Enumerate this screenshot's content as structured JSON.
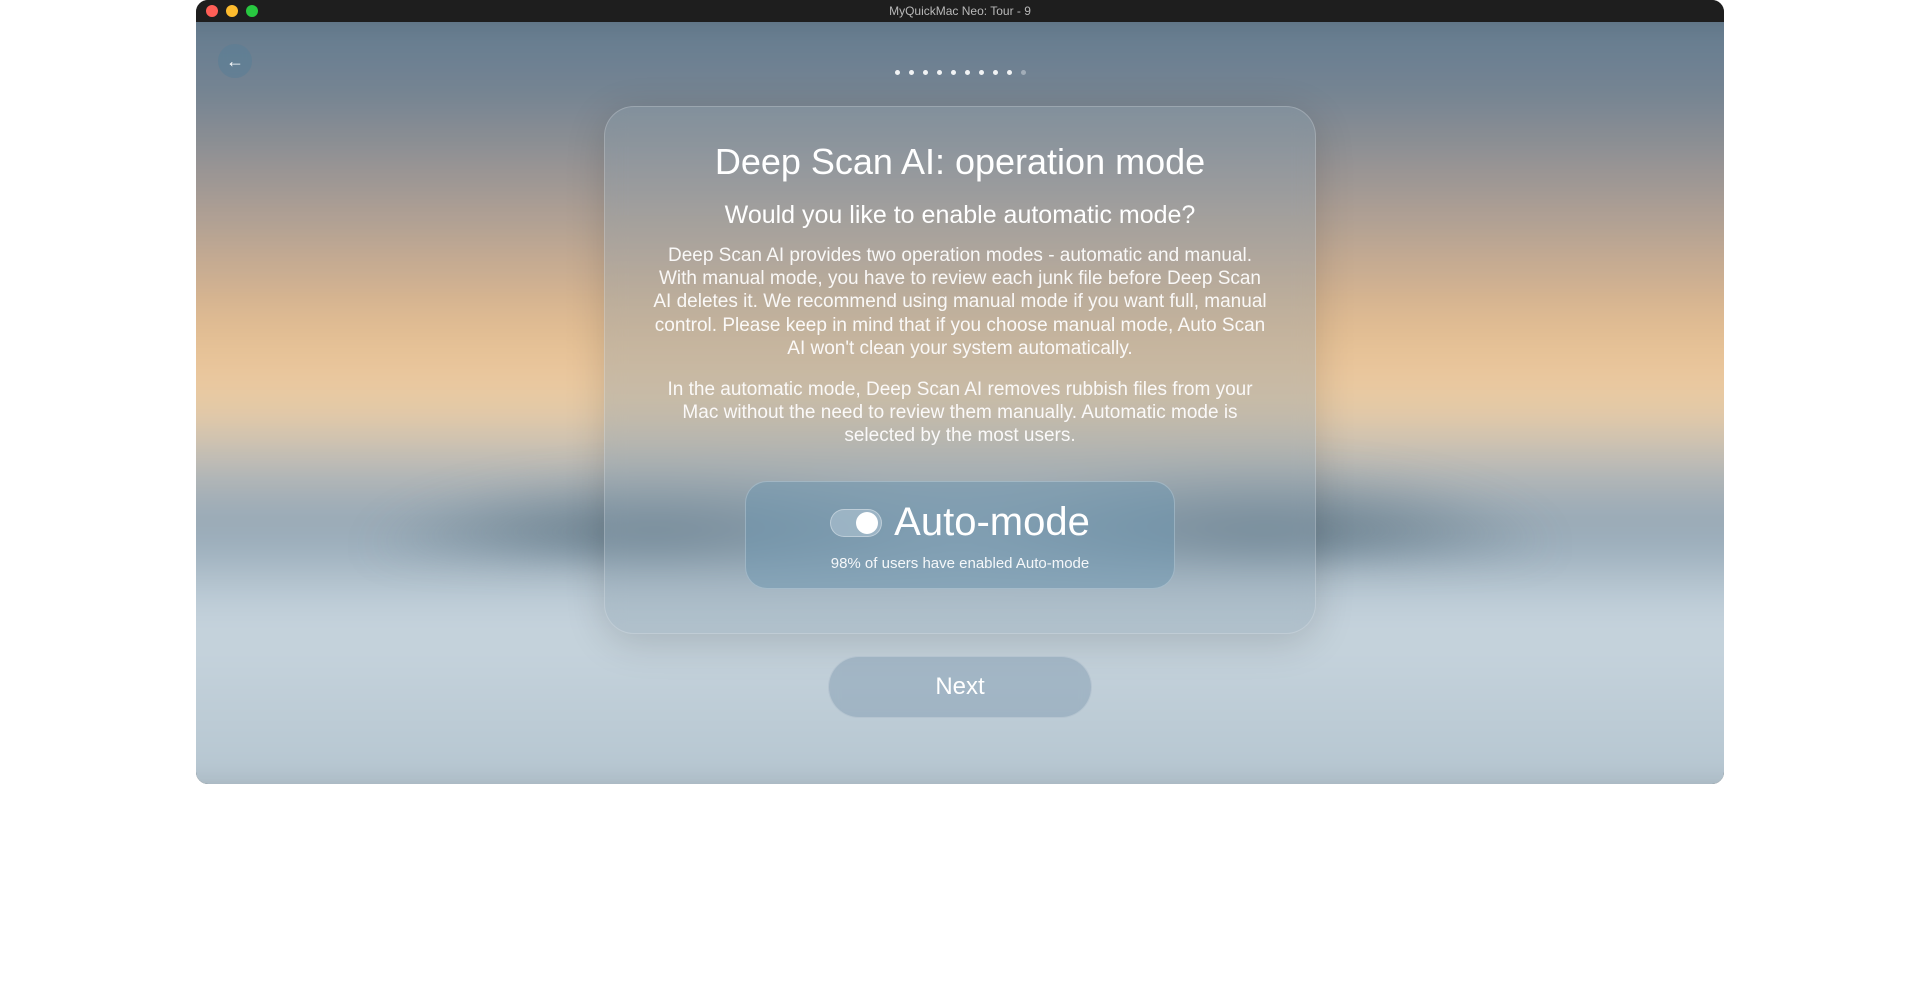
{
  "window": {
    "title": "MyQuickMac Neo: Tour - 9"
  },
  "pagination": {
    "total": 10,
    "current_index": 9
  },
  "card": {
    "heading": "Deep Scan AI: operation mode",
    "subheading": "Would you like to enable automatic mode?",
    "paragraph1": "Deep Scan AI provides two operation modes - automatic and manual. With manual mode, you have to review each junk file before Deep Scan AI deletes it. We recommend using manual mode if you want full, manual control. Please keep in mind that if you choose manual mode, Auto Scan AI won't clean your system automatically.",
    "paragraph2": "In the automatic mode, Deep Scan AI removes rubbish files from your Mac without the need to review them manually. Automatic mode is selected by the most users."
  },
  "toggle": {
    "label": "Auto-mode",
    "enabled": true,
    "subtext": "98% of users have enabled Auto-mode"
  },
  "buttons": {
    "next": "Next",
    "back_aria": "Back"
  }
}
